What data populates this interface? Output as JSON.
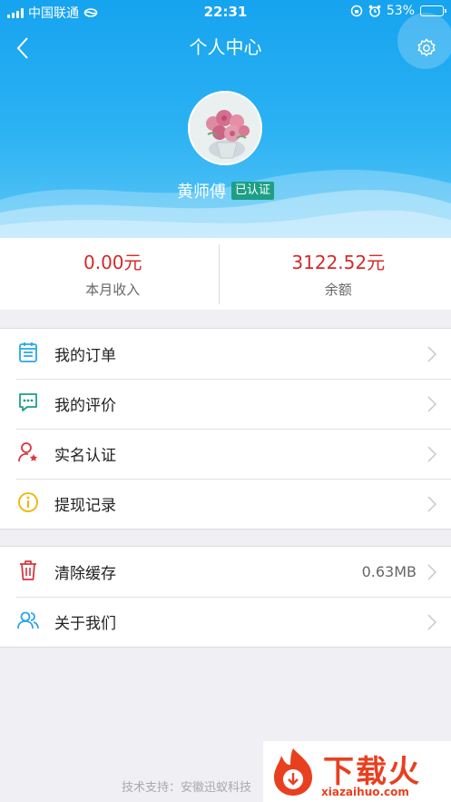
{
  "status_bar": {
    "carrier": "中国联通",
    "time": "22:31",
    "battery": "53%",
    "battery_level": 0.53
  },
  "nav": {
    "title": "个人中心"
  },
  "profile": {
    "name": "黄师傅",
    "badge": "已认证"
  },
  "stats": [
    {
      "value": "0.00元",
      "label": "本月收入"
    },
    {
      "value": "3122.52元",
      "label": "余额"
    }
  ],
  "menu_group_1": [
    {
      "label": "我的订单",
      "icon": "calendar-icon",
      "color": "#2aa6e8"
    },
    {
      "label": "我的评价",
      "icon": "comment-icon",
      "color": "#1d9f86"
    },
    {
      "label": "实名认证",
      "icon": "user-verify-icon",
      "color": "#d9363e"
    },
    {
      "label": "提现记录",
      "icon": "info-icon",
      "color": "#f0b400"
    }
  ],
  "menu_group_2": [
    {
      "label": "清除缓存",
      "icon": "trash-icon",
      "value": "0.63MB",
      "color": "#d9363e"
    },
    {
      "label": "关于我们",
      "icon": "users-icon",
      "color": "#2aa6e8"
    }
  ],
  "footer": {
    "text": "技术支持：安徽迅蚁科技"
  },
  "watermark": {
    "text": "下载火",
    "sub": "xiazaihuo.com"
  },
  "colors": {
    "header": "#16a3ef",
    "amount": "#d42a2a",
    "badge": "#1d9f86"
  }
}
